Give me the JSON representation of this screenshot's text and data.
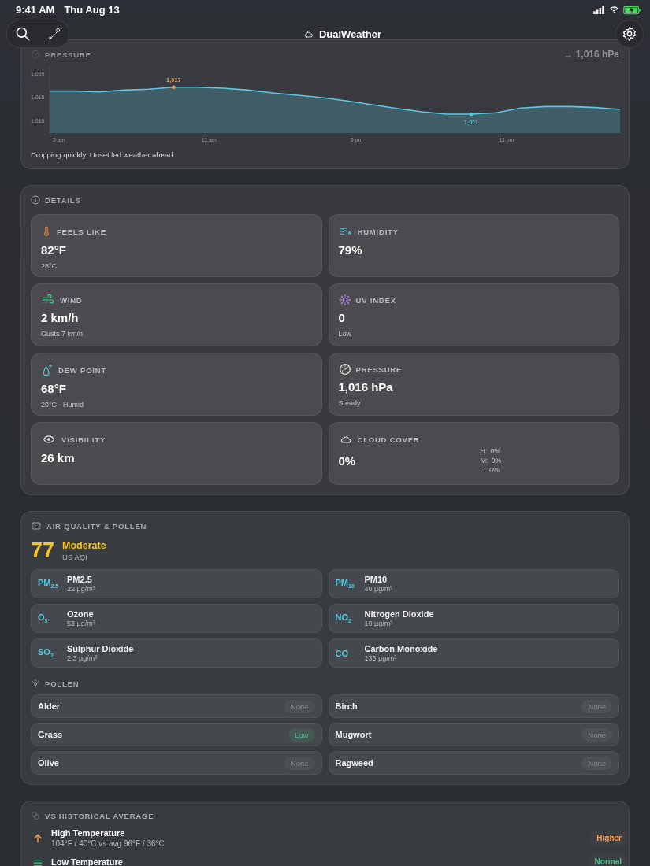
{
  "status_bar": {
    "time": "9:41 AM",
    "date": "Thu Aug 13"
  },
  "nav": {
    "title": "DualWeather"
  },
  "pressure": {
    "title": "PRESSURE",
    "reading": "1,016 hPa",
    "trend_symbol": "→",
    "note": "Dropping quickly. Unsettled weather ahead.",
    "time_labels": [
      "5 am",
      "11 am",
      "5 pm",
      "11 pm"
    ],
    "extremes": [
      {
        "kind": "high",
        "text": "1,017",
        "color": "#f0a050"
      },
      {
        "kind": "low",
        "text": "1,011",
        "color": "#5cc8e0"
      }
    ],
    "chart_data": {
      "type": "area",
      "series": [
        {
          "color": "#5cc8e0",
          "values": [
            1016.2,
            1016.2,
            1016.0,
            1016.4,
            1016.6,
            1017.0,
            1017.0,
            1016.8,
            1016.4,
            1015.8,
            1015.3,
            1014.8,
            1014.1,
            1013.3,
            1012.5,
            1011.8,
            1011.3,
            1011.3,
            1011.6,
            1012.6,
            1012.9,
            1012.9,
            1012.7,
            1012.3
          ]
        }
      ],
      "ylim": [
        1007.3,
        1021.3
      ],
      "yticks": [
        {
          "value": 1010,
          "label": "1,010"
        },
        {
          "value": 1015,
          "label": "1,015"
        },
        {
          "value": 1020,
          "label": "1,020"
        }
      ]
    }
  },
  "details": {
    "title": "DETAILS",
    "tiles": [
      {
        "kind": "thermometer",
        "label": "FEELS LIKE",
        "value": "82°F",
        "sub": "28°C"
      },
      {
        "kind": "humidity",
        "label": "HUMIDITY",
        "value": "79%"
      },
      {
        "kind": "wind",
        "label": "WIND",
        "value": "2 km/h",
        "sub": "Gusts 7 km/h"
      },
      {
        "kind": "uv",
        "label": "UV INDEX",
        "value": "0",
        "sub": "Low"
      },
      {
        "kind": "dew",
        "label": "DEW POINT",
        "value": "68°F",
        "sub": "20°C · Humid"
      },
      {
        "kind": "gauge",
        "label": "PRESSURE",
        "value": "1,016 hPa",
        "sub": "Steady"
      },
      {
        "kind": "eye",
        "label": "VISIBILITY",
        "value": "26 km"
      },
      {
        "kind": "cloud",
        "label": "CLOUD COVER",
        "value": "0%",
        "layers": [
          {
            "label": "H:",
            "value": "0%"
          },
          {
            "label": "M:",
            "value": "0%"
          },
          {
            "label": "L:",
            "value": "0%"
          }
        ]
      }
    ]
  },
  "air_quality": {
    "title": "AIR QUALITY & POLLEN",
    "aqi": "77",
    "category": "Moderate",
    "scale": "US AQI",
    "pollutants": [
      {
        "symbol": "PM$_{2.5}$",
        "name": "PM2.5",
        "value": "22 µg/m³"
      },
      {
        "symbol": "PM$_{10}$",
        "name": "PM10",
        "value": "40 µg/m³"
      },
      {
        "symbol": "O$_{3}$",
        "name": "Ozone",
        "value": "53 µg/m³"
      },
      {
        "symbol": "NO$_{2}$",
        "name": "Nitrogen Dioxide",
        "value": "10 µg/m³"
      },
      {
        "symbol": "SO$_{2}$",
        "name": "Sulphur Dioxide",
        "value": "2.3 µg/m³"
      },
      {
        "symbol": "CO",
        "name": "Carbon Monoxide",
        "value": "135 µg/m³"
      }
    ],
    "pollen_title": "POLLEN",
    "pollen": [
      {
        "name": "Alder",
        "level": "None",
        "color": "#8a8f96"
      },
      {
        "name": "Birch",
        "level": "None",
        "color": "#8a8f96"
      },
      {
        "name": "Grass",
        "level": "Low",
        "color": "#4cc38a"
      },
      {
        "name": "Mugwort",
        "level": "None",
        "color": "#8a8f96"
      },
      {
        "name": "Olive",
        "level": "None",
        "color": "#8a8f96"
      },
      {
        "name": "Ragweed",
        "level": "None",
        "color": "#8a8f96"
      }
    ]
  },
  "historical": {
    "title": "VS HISTORICAL AVERAGE",
    "items": [
      {
        "kind": "up",
        "name": "High Temperature",
        "detail": "104°F / 40°C vs avg 96°F / 36°C",
        "badge": "Higher",
        "color": "#f0a050"
      },
      {
        "kind": "equal",
        "name": "Low Temperature",
        "badge": "Normal",
        "color": "#4cc38a"
      }
    ]
  }
}
